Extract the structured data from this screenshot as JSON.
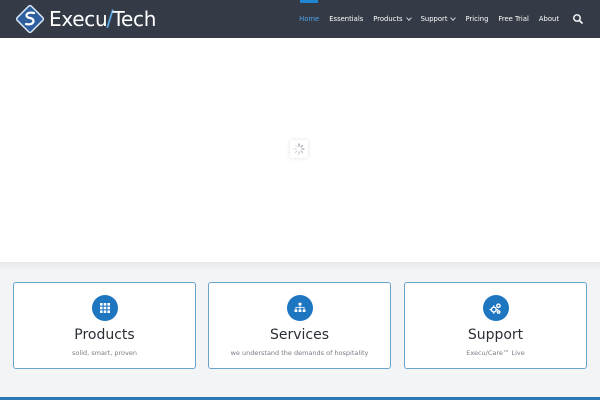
{
  "brand": {
    "name_left": "Execu",
    "name_right": "Tech",
    "slash": "/",
    "accent_color": "#1f86d4",
    "header_bg": "#353b46"
  },
  "nav": {
    "items": [
      {
        "label": "Home",
        "active": true
      },
      {
        "label": "Essentials"
      },
      {
        "label": "Products",
        "dropdown": true
      },
      {
        "label": "Support",
        "dropdown": true
      },
      {
        "label": "Pricing"
      },
      {
        "label": "Free Trial"
      },
      {
        "label": "About"
      }
    ],
    "search_icon": "search-icon"
  },
  "hero": {
    "loading_icon": "spinner-icon"
  },
  "cards": [
    {
      "icon": "grid-icon",
      "title": "Products",
      "subtitle": "solid, smart, proven"
    },
    {
      "icon": "org-chart-icon",
      "title": "Services",
      "subtitle": "we understand the demands of hospitality"
    },
    {
      "icon": "gears-icon",
      "title": "Support",
      "subtitle": "Execu/Care™ Live"
    }
  ]
}
